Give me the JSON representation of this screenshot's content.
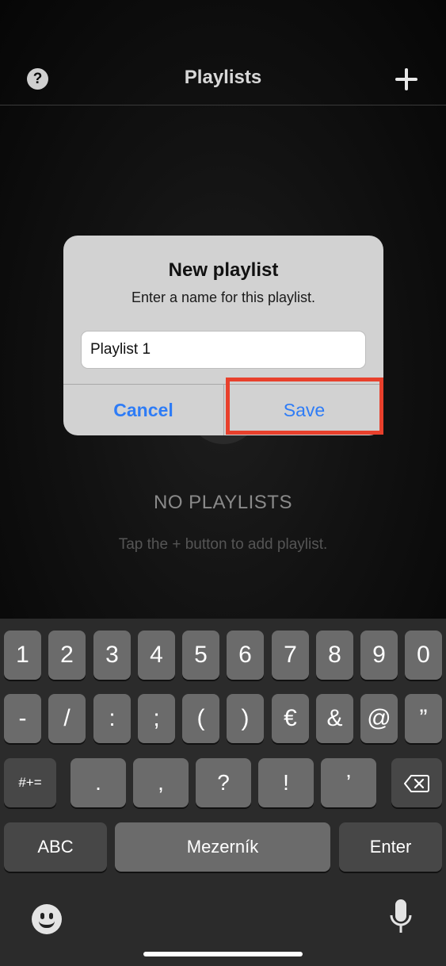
{
  "header": {
    "title": "Playlists",
    "help_icon": "?",
    "add_icon": "plus-icon"
  },
  "empty_state": {
    "title": "NO PLAYLISTS",
    "subtitle": "Tap the + button to add playlist."
  },
  "dialog": {
    "title": "New playlist",
    "message": "Enter a name for this playlist.",
    "input_value": "Playlist 1",
    "cancel_label": "Cancel",
    "save_label": "Save"
  },
  "keyboard": {
    "row1": [
      "1",
      "2",
      "3",
      "4",
      "5",
      "6",
      "7",
      "8",
      "9",
      "0"
    ],
    "row2": [
      "-",
      "/",
      ":",
      ";",
      "(",
      ")",
      "€",
      "&",
      "@",
      "”"
    ],
    "row3": [
      ".",
      ",",
      "?",
      "!",
      "’"
    ],
    "more_symbols": "#+=",
    "abc": "ABC",
    "space": "Mezerník",
    "enter": "Enter"
  },
  "colors": {
    "accent": "#2e7cf6",
    "highlight": "#e8402c"
  }
}
